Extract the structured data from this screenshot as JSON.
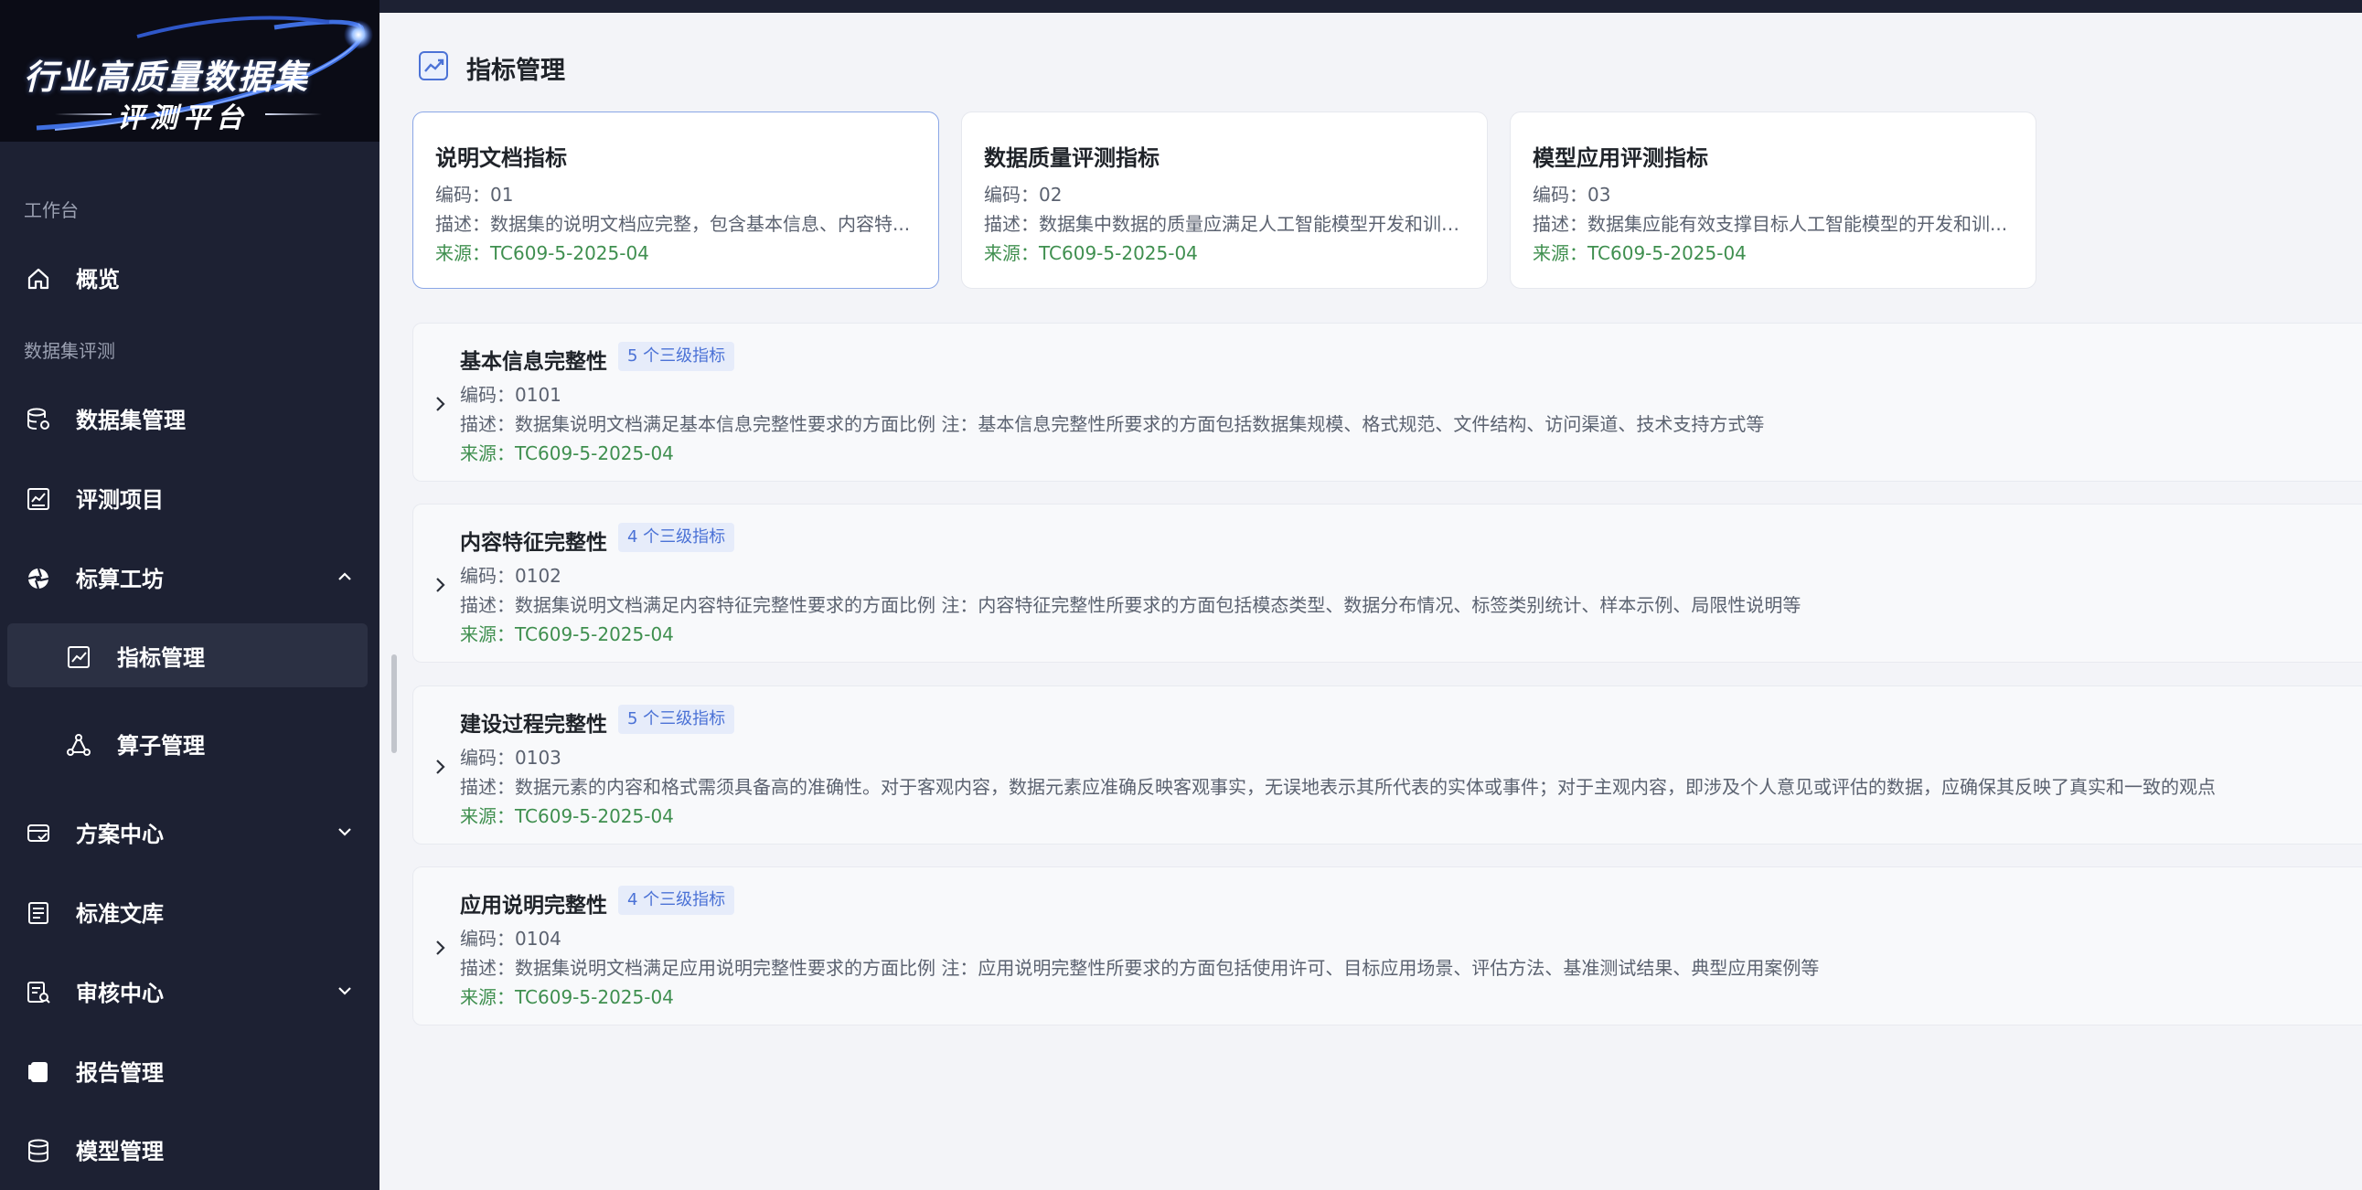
{
  "brand": {
    "line1": "行业高质量数据集",
    "line2": "评测平台"
  },
  "sidebar": {
    "sections": [
      {
        "label": "工作台"
      },
      {
        "label": "数据集评测"
      }
    ],
    "items": [
      {
        "label": "概览",
        "icon": "home-icon"
      },
      {
        "label": "数据集管理",
        "icon": "database-settings-icon"
      },
      {
        "label": "评测项目",
        "icon": "chart-board-icon"
      },
      {
        "label": "标算工坊",
        "icon": "aperture-icon",
        "expanded": true
      },
      {
        "label": "指标管理",
        "icon": "trend-chart-icon",
        "active": true
      },
      {
        "label": "算子管理",
        "icon": "nodes-icon"
      },
      {
        "label": "方案中心",
        "icon": "card-check-icon",
        "expanded": false
      },
      {
        "label": "标准文库",
        "icon": "document-icon"
      },
      {
        "label": "审核中心",
        "icon": "audit-icon",
        "expanded": false
      },
      {
        "label": "报告管理",
        "icon": "report-icon"
      },
      {
        "label": "模型管理",
        "icon": "database-icon"
      }
    ]
  },
  "page": {
    "title": "指标管理"
  },
  "cards": [
    {
      "title": "说明文档指标",
      "code": "编码：01",
      "desc": "描述：数据集的说明文档应完整，包含基本信息、内容特...",
      "source": "来源：TC609-5-2025-04",
      "selected": true
    },
    {
      "title": "数据质量评测指标",
      "code": "编码：02",
      "desc": "描述：数据集中数据的质量应满足人工智能模型开发和训练...",
      "source": "来源：TC609-5-2025-04",
      "selected": false
    },
    {
      "title": "模型应用评测指标",
      "code": "编码：03",
      "desc": "描述：数据集应能有效支撑目标人工智能模型的开发和训...",
      "source": "来源：TC609-5-2025-04",
      "selected": false
    }
  ],
  "rows": [
    {
      "title": "基本信息完整性",
      "badge": "5 个三级指标",
      "code": "编码：0101",
      "desc": "描述：数据集说明文档满足基本信息完整性要求的方面比例 注：基本信息完整性所要求的方面包括数据集规模、格式规范、文件结构、访问渠道、技术支持方式等",
      "source": "来源：TC609-5-2025-04"
    },
    {
      "title": "内容特征完整性",
      "badge": "4 个三级指标",
      "code": "编码：0102",
      "desc": "描述：数据集说明文档满足内容特征完整性要求的方面比例 注：内容特征完整性所要求的方面包括模态类型、数据分布情况、标签类别统计、样本示例、局限性说明等",
      "source": "来源：TC609-5-2025-04"
    },
    {
      "title": "建设过程完整性",
      "badge": "5 个三级指标",
      "code": "编码：0103",
      "desc": "描述：数据元素的内容和格式需须具备高的准确性。对于客观内容，数据元素应准确反映客观事实，无误地表示其所代表的实体或事件；对于主观内容，即涉及个人意见或评估的数据，应确保其反映了真实和一致的观点",
      "source": "来源：TC609-5-2025-04"
    },
    {
      "title": "应用说明完整性",
      "badge": "4 个三级指标",
      "code": "编码：0104",
      "desc": "描述：数据集说明文档满足应用说明完整性要求的方面比例 注：应用说明完整性所要求的方面包括使用许可、目标应用场景、评估方法、基准测试结果、典型应用案例等",
      "source": "来源：TC609-5-2025-04"
    }
  ],
  "colors": {
    "sidebar_bg": "#1d2133",
    "active_bg": "#2b3043",
    "accent": "#4b72d6",
    "source_green": "#3f8f4f",
    "selected_border": "#8aa6e6"
  }
}
